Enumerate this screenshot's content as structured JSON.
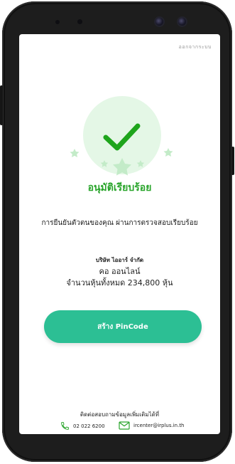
{
  "header": {
    "logout_label": "ออกจากระบบ"
  },
  "hero": {
    "icon": "check-icon",
    "accent": "#2aa52c",
    "circle_bg": "#e4f7e6"
  },
  "status": {
    "title": "อนุมัติเรียบร้อย",
    "description": "การยืนยันตัวตนของคุณ ผ่านการตรวจสอบเรียบร้อย"
  },
  "info": {
    "company": "บริษัท ไออาร์ จำกัด",
    "holder_name": "คอ ออนไลน์",
    "shares": "จำนวนหุ้นทั้งหมด 234,800 หุ้น"
  },
  "actions": {
    "create_pin_label": "สร้าง PinCode",
    "button_color": "#2cbf94"
  },
  "contact": {
    "title": "ติดต่อสอบถามข้อมูลเพิ่มเติมได้ที่",
    "phone": "02 022 6200",
    "email": "ircenter@irplus.in.th"
  }
}
